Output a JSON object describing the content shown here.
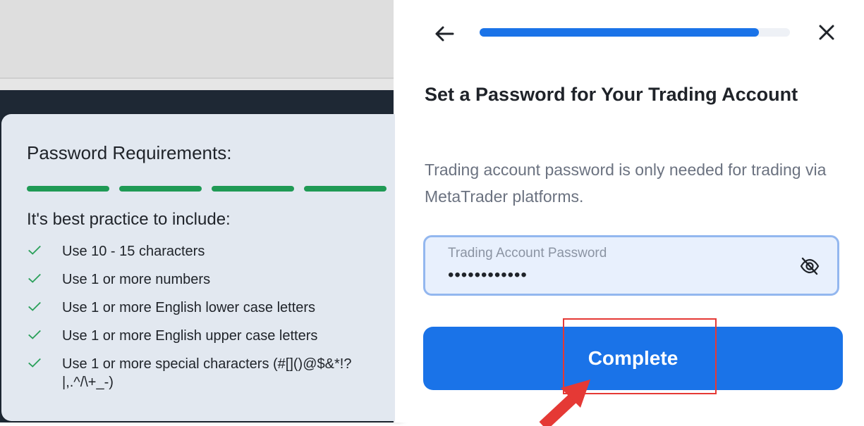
{
  "popover": {
    "title": "Password Requirements:",
    "strength_segments_filled": 4,
    "subtitle": "It's best practice to include:",
    "requirements": [
      "Use 10 - 15 characters",
      "Use 1 or more numbers",
      "Use 1 or more English lower case letters",
      "Use 1 or more English upper case letters",
      "Use 1 or more special characters (#[]()@$&*!?|,.^/\\+_-)"
    ],
    "check_icon": "check-icon",
    "strength_color": "#1f9a55"
  },
  "panel": {
    "progress": 0.9,
    "back_icon": "arrow-left-icon",
    "close_icon": "close-icon",
    "title": "Set a Password for Your Trading Account",
    "description": "Trading account password is only needed for trading via MetaTrader platforms.",
    "password_field": {
      "label": "Trading Account Password",
      "value": "••••••••••••",
      "visibility_icon": "eye-off-icon"
    },
    "complete_label": "Complete",
    "accent_color": "#1a73e8"
  }
}
